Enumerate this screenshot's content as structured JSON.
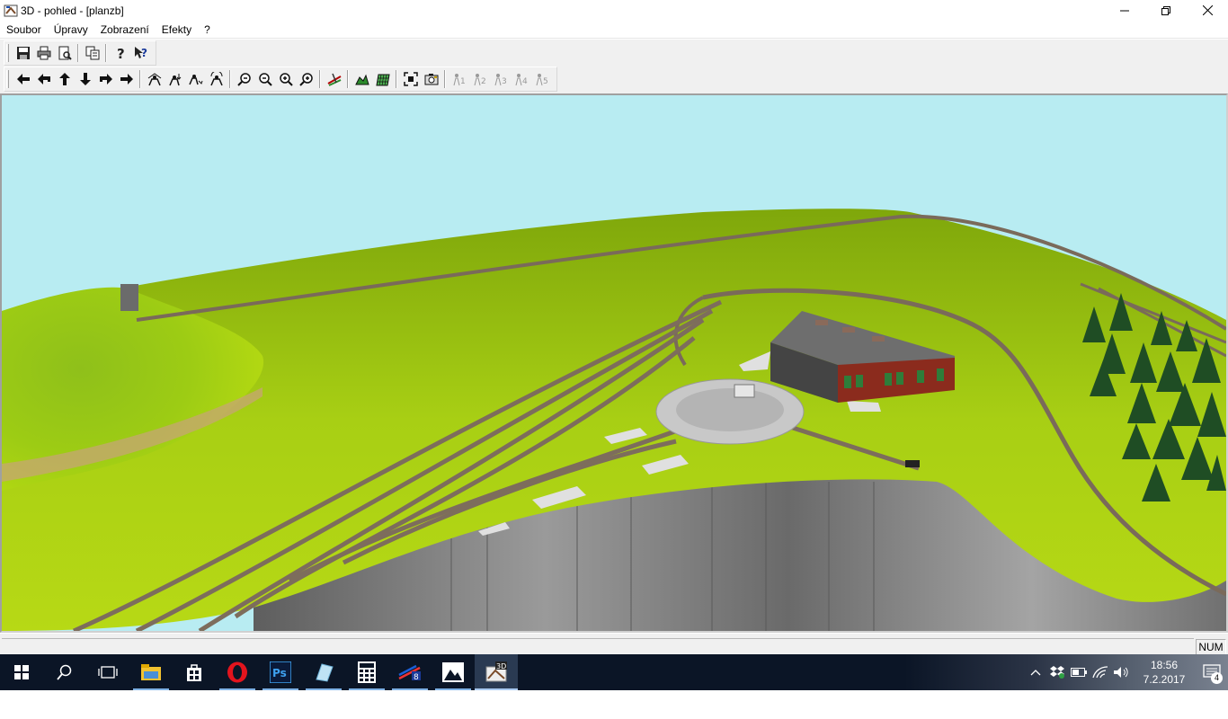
{
  "window": {
    "title": "3D - pohled - [planzb]",
    "icon": "layout-3d-app-icon",
    "controls": [
      "minimize",
      "restore",
      "close"
    ]
  },
  "menu": {
    "items": [
      "Soubor",
      "Úpravy",
      "Zobrazení",
      "Efekty",
      "?"
    ]
  },
  "toolbar_main": {
    "buttons": [
      "save-icon",
      "print-icon",
      "print-preview-icon",
      "copy-icon",
      "help-icon",
      "context-help-icon"
    ]
  },
  "toolbar_view": {
    "buttons": [
      "move-left-icon",
      "turn-left-icon",
      "move-forward-icon",
      "move-back-icon",
      "turn-right-icon",
      "move-right-icon",
      "camera-up-icon",
      "camera-down-icon",
      "camera-tilt-icon",
      "camera-reset-icon",
      "zoom-out-icon",
      "zoom-out-small-icon",
      "zoom-in-small-icon",
      "zoom-in-icon",
      "track-icon",
      "terrain-icon",
      "grid-icon",
      "fit-view-icon",
      "snapshot-icon",
      "camera-1-icon",
      "camera-2-icon",
      "camera-3-icon",
      "camera-4-icon",
      "camera-5-icon"
    ],
    "camera_labels": [
      "1",
      "2",
      "3",
      "4",
      "5"
    ]
  },
  "scene": {
    "description_colors": {
      "sky": "#b8ecf2",
      "grass": "#a8cf14",
      "grass_dark": "#7fa70b",
      "cliff": "#7d7d7d",
      "track": "#8b7a6a",
      "roof": "#6e6e6e",
      "brick": "#8b2b1d"
    }
  },
  "statusbar": {
    "num_indicator": "NUM"
  },
  "taskbar": {
    "apps": [
      "start-icon",
      "search-icon",
      "task-view-icon",
      "file-explorer-icon",
      "store-icon",
      "opera-icon",
      "photoshop-icon",
      "notes-icon",
      "calculator-icon",
      "railway-app-icon",
      "photos-icon",
      "3d-view-app-icon"
    ],
    "photoshop_label": "Ps",
    "active_label": "3D",
    "time": "18:56",
    "date": "7.2.2017",
    "notification_count": "4"
  }
}
